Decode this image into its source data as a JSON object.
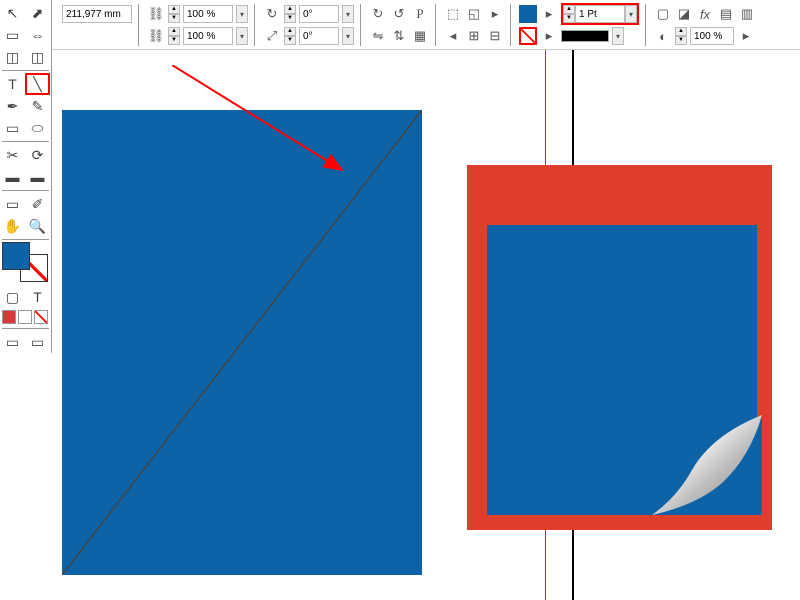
{
  "toolbar": {
    "position_value": "211,977 mm",
    "scale_x": "100 %",
    "scale_y": "100 %",
    "rotate1": "0°",
    "rotate2": "0°",
    "stroke_weight": "1 Pt",
    "opacity": "100 %",
    "fill_color": "#0d63a5",
    "stroke_color": "#000000"
  },
  "toolbox": {
    "active_tool": "line-tool",
    "fg_color": "#0d63a5",
    "accent_color": "#d93838"
  },
  "canvas": {
    "left_shape": {
      "type": "rect",
      "fill": "#0d63a5",
      "line": "diagonal"
    },
    "right_group": {
      "outer_fill": "#df3e2d",
      "inner_fill": "#0d63a5",
      "has_page_curl": true
    }
  },
  "annotations": {
    "arrow_note": "points to line tool result",
    "highlighted_controls": [
      "line-tool",
      "no-stroke-button",
      "stroke-weight-field"
    ]
  }
}
